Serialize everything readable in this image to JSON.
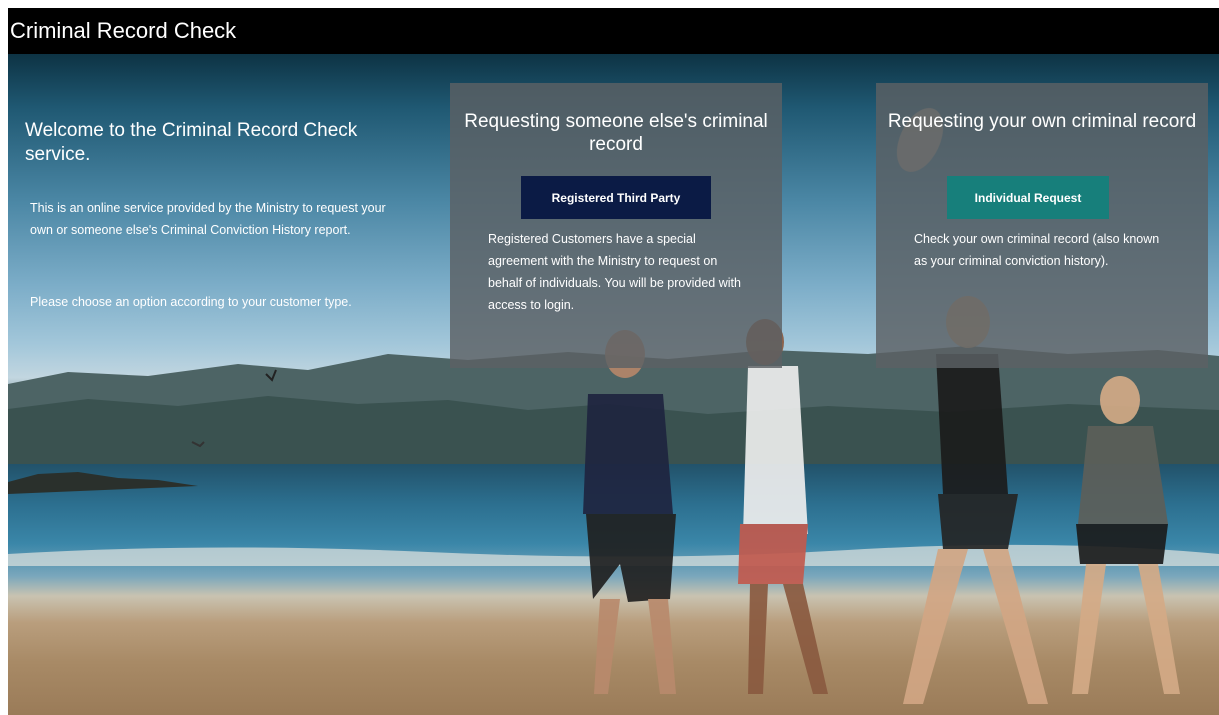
{
  "header": {
    "title": "Criminal Record Check"
  },
  "intro": {
    "heading": "Welcome to the Criminal Record Check service.",
    "paragraph1": "This is an online service provided by the Ministry to request your own or someone else's Criminal Conviction History report.",
    "paragraph2": "Please choose an option according to your customer type."
  },
  "panels": [
    {
      "heading": "Requesting someone else's criminal record",
      "button_label": "Registered Third Party",
      "description": "Registered Customers have a special agreement with the Ministry to request on behalf of individuals. You will be provided with access to login."
    },
    {
      "heading": "Requesting your own criminal record",
      "button_label": "Individual Request",
      "description": "Check your own criminal record (also known as your criminal conviction history)."
    }
  ],
  "colors": {
    "header_bg": "#000000",
    "third_party_button": "#0b1b45",
    "individual_button": "#177f7b",
    "panel_overlay": "#5c6064"
  }
}
